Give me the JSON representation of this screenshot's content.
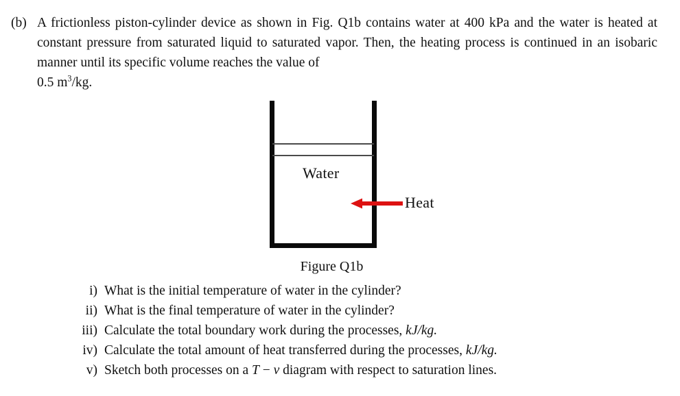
{
  "problem": {
    "label": "(b)",
    "paragraph_main": "A frictionless piston-cylinder device as shown in Fig. Q1b contains water at 400 kPa and the water is heated at constant pressure from saturated liquid to saturated vapor.  Then, the heating process is continued in an isobaric manner until its specific volume reaches the value of",
    "paragraph_tail_prefix": "0.5 m",
    "paragraph_tail_sup": "3",
    "paragraph_tail_suffix": "/kg."
  },
  "figure": {
    "water_label": "Water",
    "heat_label": "Heat",
    "caption": "Figure Q1b",
    "arrow_color": "#DD1111",
    "arrow_direction": "left",
    "wall_color": "#0A0A0A",
    "piston_line_color": "#4A4A4A"
  },
  "questions": [
    {
      "numeral": "i)",
      "text": "What is the initial temperature of water in the cylinder?",
      "emphasis": ""
    },
    {
      "numeral": "ii)",
      "text": "What is the final temperature of water in the cylinder?",
      "emphasis": ""
    },
    {
      "numeral": "iii)",
      "text": "Calculate the total boundary work during the processes,",
      "emphasis": "kJ/kg."
    },
    {
      "numeral": "iv)",
      "text": "Calculate the total amount of heat transferred during the processes,",
      "emphasis": "kJ/kg."
    },
    {
      "numeral": "v)",
      "text_before": "Sketch both processes on a",
      "var1": "T",
      "dash": "−",
      "var2": "v",
      "text_after": "diagram with respect to saturation lines."
    }
  ]
}
